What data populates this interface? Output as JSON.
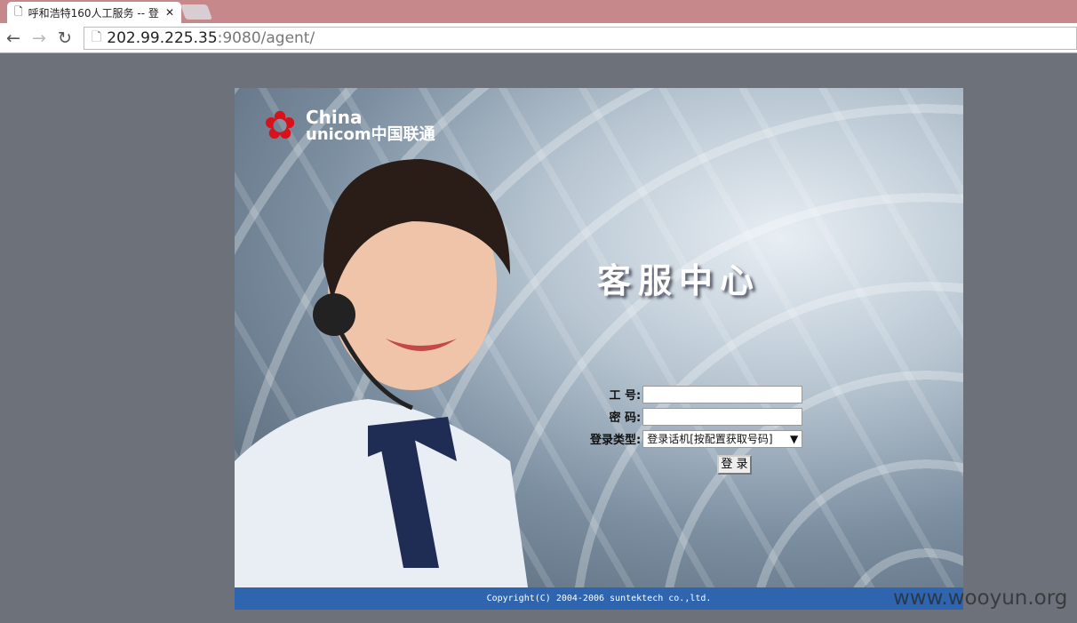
{
  "browser": {
    "tab_title": "呼和浩特160人工服务 -- 登",
    "url_host": "202.99.225.35",
    "url_rest": ":9080/agent/"
  },
  "logo": {
    "line1": "China",
    "line2": "unicom中国联通"
  },
  "page": {
    "heading": "客服中心",
    "form": {
      "id_label": "工  号:",
      "id_value": "",
      "password_label": "密  码:",
      "password_value": "",
      "type_label": "登录类型:",
      "type_selected": "登录话机[按配置获取号码]",
      "login_button": "登 录"
    },
    "footer": "Copyright(C) 2004-2006 suntektech co.,ltd."
  },
  "watermark": "www.wooyun.org"
}
